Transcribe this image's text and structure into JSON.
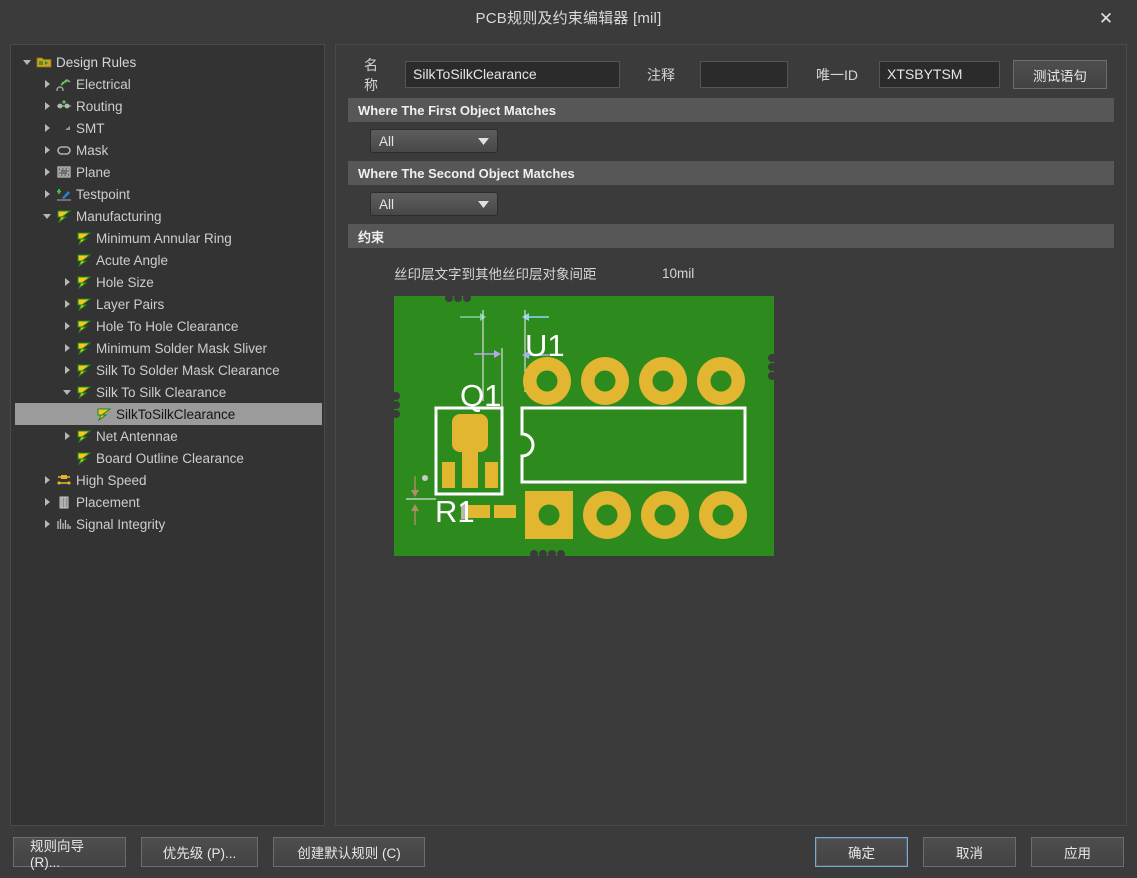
{
  "window": {
    "title": "PCB规则及约束编辑器 [mil]",
    "close_label": "✕"
  },
  "tree": {
    "items": [
      {
        "label": "Design Rules",
        "depth": 0,
        "icon": "design-rules-folder-icon",
        "expander": "down",
        "selected": false
      },
      {
        "label": "Electrical",
        "depth": 1,
        "icon": "electrical-icon",
        "expander": "right",
        "selected": false
      },
      {
        "label": "Routing",
        "depth": 1,
        "icon": "routing-icon",
        "expander": "right",
        "selected": false
      },
      {
        "label": "SMT",
        "depth": 1,
        "icon": "smt-icon",
        "expander": "right",
        "selected": false
      },
      {
        "label": "Mask",
        "depth": 1,
        "icon": "mask-icon",
        "expander": "right",
        "selected": false
      },
      {
        "label": "Plane",
        "depth": 1,
        "icon": "plane-icon",
        "expander": "right",
        "selected": false
      },
      {
        "label": "Testpoint",
        "depth": 1,
        "icon": "testpoint-icon",
        "expander": "right",
        "selected": false
      },
      {
        "label": "Manufacturing",
        "depth": 1,
        "icon": "manufacturing-icon",
        "expander": "down",
        "selected": false
      },
      {
        "label": "Minimum Annular Ring",
        "depth": 2,
        "icon": "rule-icon",
        "expander": "none",
        "selected": false
      },
      {
        "label": "Acute Angle",
        "depth": 2,
        "icon": "rule-icon",
        "expander": "none",
        "selected": false
      },
      {
        "label": "Hole Size",
        "depth": 2,
        "icon": "rule-icon",
        "expander": "right",
        "selected": false
      },
      {
        "label": "Layer Pairs",
        "depth": 2,
        "icon": "rule-icon",
        "expander": "right",
        "selected": false
      },
      {
        "label": "Hole To Hole Clearance",
        "depth": 2,
        "icon": "rule-icon",
        "expander": "right",
        "selected": false
      },
      {
        "label": "Minimum Solder Mask Sliver",
        "depth": 2,
        "icon": "rule-icon",
        "expander": "right",
        "selected": false
      },
      {
        "label": "Silk To Solder Mask Clearance",
        "depth": 2,
        "icon": "rule-icon",
        "expander": "right",
        "selected": false
      },
      {
        "label": "Silk To Silk Clearance",
        "depth": 2,
        "icon": "rule-icon",
        "expander": "down",
        "selected": false
      },
      {
        "label": "SilkToSilkClearance",
        "depth": 3,
        "icon": "rule-icon",
        "expander": "none",
        "selected": true
      },
      {
        "label": "Net Antennae",
        "depth": 2,
        "icon": "rule-icon",
        "expander": "right",
        "selected": false
      },
      {
        "label": "Board Outline Clearance",
        "depth": 2,
        "icon": "rule-icon",
        "expander": "none",
        "selected": false
      },
      {
        "label": "High Speed",
        "depth": 1,
        "icon": "high-speed-icon",
        "expander": "right",
        "selected": false
      },
      {
        "label": "Placement",
        "depth": 1,
        "icon": "placement-icon",
        "expander": "right",
        "selected": false
      },
      {
        "label": "Signal Integrity",
        "depth": 1,
        "icon": "signal-integrity-icon",
        "expander": "right",
        "selected": false
      }
    ]
  },
  "form": {
    "name_label": "名称",
    "name_value": "SilkToSilkClearance",
    "comment_label": "注释",
    "comment_value": "",
    "uniqueid_label": "唯一ID",
    "uniqueid_value": "XTSBYTSM",
    "test_query_button": "测试语句"
  },
  "sections": {
    "first_object": "Where The First Object Matches",
    "second_object": "Where The Second Object Matches",
    "constraints": "约束"
  },
  "scope": {
    "first_value": "All",
    "second_value": "All"
  },
  "constraint": {
    "name": "丝印层文字到其他丝印层对象间距",
    "value": "10mil"
  },
  "preview": {
    "designator_u1": "U1",
    "designator_q1": "Q1",
    "designator_r1": "R1",
    "board_color": "#2d8a1d",
    "pad_color": "#e3b631",
    "silk_color": "#ffffff"
  },
  "footer": {
    "rule_wizard": "规则向导 (R)...",
    "priorities": "优先级 (P)...",
    "create_default_rules": "创建默认规则 (C)",
    "ok": "确定",
    "cancel": "取消",
    "apply": "应用"
  }
}
